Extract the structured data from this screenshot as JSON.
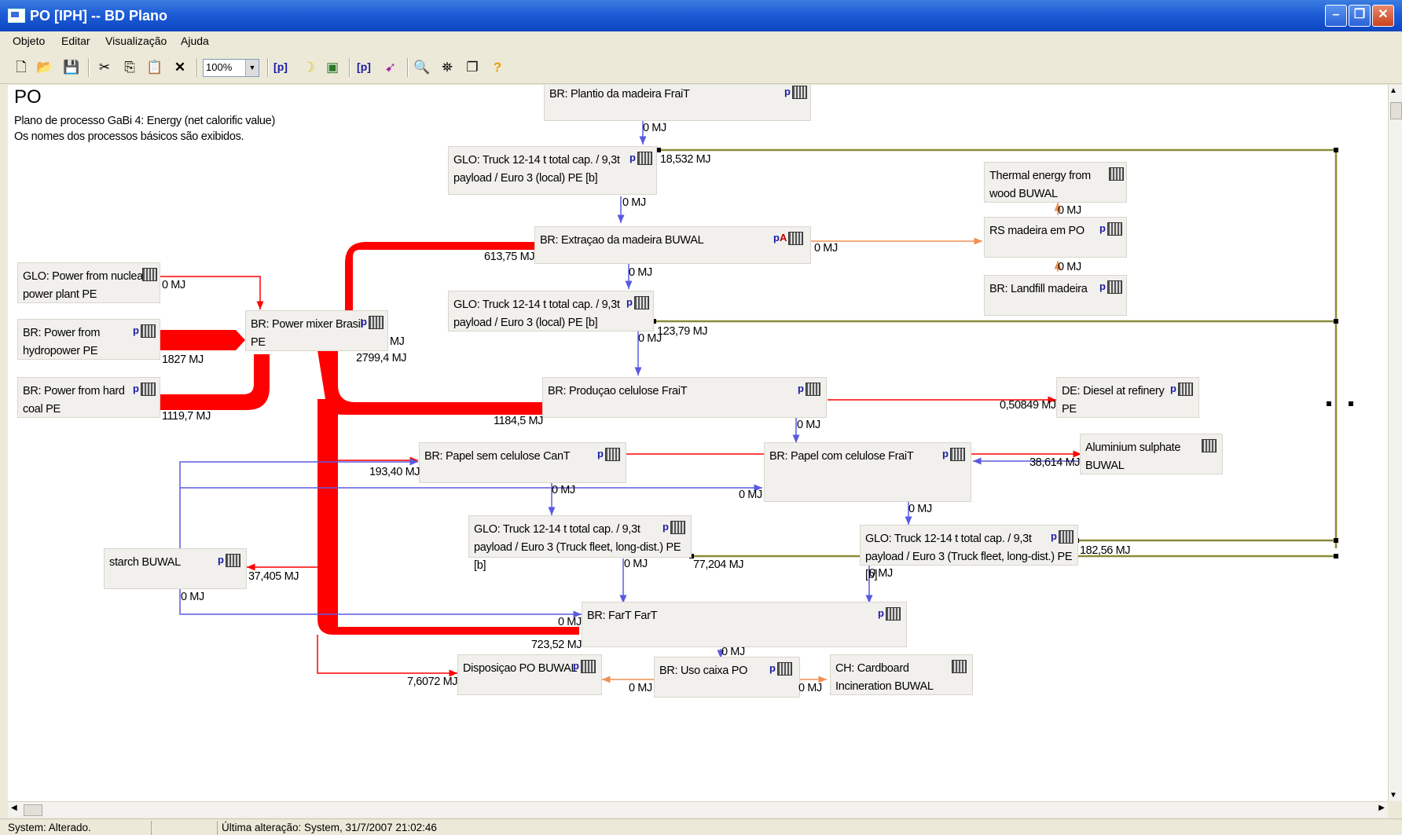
{
  "window": {
    "title": "PO [IPH] -- BD Plano",
    "minimize": "–",
    "restore": "❐",
    "close": "✕"
  },
  "menu": [
    "Objeto",
    "Editar",
    "Visualização",
    "Ajuda"
  ],
  "toolbar": {
    "zoom": "100%",
    "buttons": [
      "new-icon",
      "open-icon",
      "save-icon",
      "cut-icon",
      "copy-icon",
      "paste-icon",
      "delete-icon",
      "zoom-select",
      "process-icon",
      "moon-icon",
      "copy-window-icon",
      "plan-icon",
      "link-icon",
      "preview-icon",
      "find-icon",
      "windows-icon",
      "help-icon"
    ]
  },
  "header": {
    "title": "PO",
    "line1": "Plano de processo GaBi 4: Energy (net calorific value)",
    "line2": "Os nomes dos processos básicos são exibidos."
  },
  "processes": {
    "plantio": "BR: Plantio da madeira FraiT",
    "truck1": "GLO: Truck 12-14 t total cap. / 9,3t\npayload / Euro 3 (local) PE [b]",
    "extracao": "BR: Extraçao da madeira BUWAL",
    "truck2": "GLO: Truck 12-14 t total cap. / 9,3t\npayload / Euro 3 (local) PE [b]",
    "thermal": "Thermal energy from\nwood BUWAL",
    "rs": "RS madeira em PO",
    "landfill": "BR: Landfill madeira",
    "nuclear": "GLO: Power from nuclear\npower plant PE",
    "hydro": "BR: Power from\nhydropower PE",
    "coal": "BR: Power from hard\ncoal PE",
    "mixer": "BR: Power mixer Brasil\nPE",
    "producao": "BR: Produçao celulose FraiT",
    "diesel": "DE: Diesel at refinery\nPE",
    "papelsem": "BR: Papel sem celulose CanT",
    "papelcom": "BR: Papel com celulose FraiT",
    "aluminium": "Aluminium sulphate\nBUWAL",
    "truck3": "GLO: Truck 12-14 t total cap. / 9,3t\npayload / Euro 3 (Truck fleet, long-dist.) PE [b]",
    "truck4": "GLO: Truck 12-14 t total cap. / 9,3t\npayload / Euro 3 (Truck fleet, long-dist.) PE [b]",
    "starch": "starch BUWAL",
    "fart": "BR: FarT FarT",
    "disposicao": "Disposiçao PO BUWAL",
    "uso": "BR: Uso caixa PO",
    "cardboard": "CH: Cardboard\nIncineration BUWAL"
  },
  "flows": {
    "f1": "0 MJ",
    "f2": "18,532 MJ",
    "f3": "0 MJ",
    "f4": "613,75 MJ",
    "f5": "0 MJ",
    "f6": "0 MJ",
    "f7": "0 MJ",
    "f8": "0 MJ",
    "f9": "0 MJ",
    "f10": "123,79 MJ",
    "f11": "0 MJ",
    "f12": "1827 MJ",
    "f13": "1119,7 MJ",
    "f14": "MJ",
    "f15": "2799,4 MJ",
    "f16": "1184,5 MJ",
    "f17": "0,50849 MJ",
    "f18": "0 MJ",
    "f19": "193,40 MJ",
    "f20": "38,614 MJ",
    "f21": "0 MJ",
    "f22": "0 MJ",
    "f23": "0 MJ",
    "f24": "0 MJ",
    "f25": "77,204 MJ",
    "f26": "182,56 MJ",
    "f27": "0 MJ",
    "f28": "37,405 MJ",
    "f29": "0 MJ",
    "f30": "0 MJ",
    "f31": "723,52 MJ",
    "f32": "0 MJ",
    "f33": "7,6072 MJ",
    "f34": "0 MJ",
    "f35": "0 MJ"
  },
  "status": {
    "left": "System: Alterado.",
    "right": "Última alteração: System, 31/7/2007 21:02:46"
  },
  "colors": {
    "energy": "#ff0000",
    "material": "#6a6ae0",
    "transport": "#8a8a3a",
    "waste": "#f0a060"
  }
}
